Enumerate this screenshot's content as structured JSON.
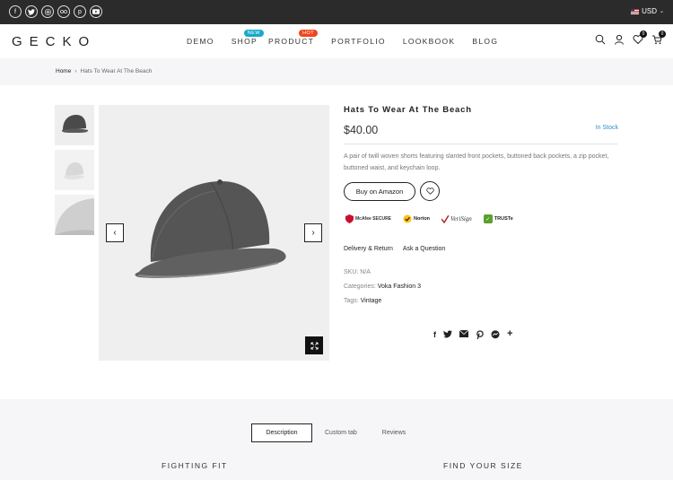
{
  "topbar": {
    "social": [
      "facebook-icon",
      "twitter-icon",
      "instagram-icon",
      "flickr-icon",
      "pinterest-icon",
      "youtube-icon"
    ],
    "currency": "USD"
  },
  "header": {
    "logo": "GECKO",
    "nav": [
      {
        "label": "DEMO"
      },
      {
        "label": "SHOP",
        "badge": "NEW"
      },
      {
        "label": "PRODUCT",
        "badge": "HOT"
      },
      {
        "label": "PORTFOLIO"
      },
      {
        "label": "LOOKBOOK"
      },
      {
        "label": "BLOG"
      }
    ],
    "wishlist_count": "0",
    "cart_count": "0"
  },
  "breadcrumb": {
    "home": "Home",
    "separator": "›",
    "current": "Hats To Wear At The Beach"
  },
  "product": {
    "title": "Hats To Wear At The Beach",
    "price": "$40.00",
    "stock": "In Stock",
    "description": "A pair of twill woven shorts featuring slanted front pockets, buttoned back pockets, a zip pocket, buttoned waist, and keychain loop.",
    "buy_label": "Buy on Amazon",
    "trust_badges": [
      "McAfee SECURE",
      "Norton",
      "VeriSign",
      "TRUSTe"
    ],
    "links": [
      "Delivery & Return",
      "Ask a Question"
    ],
    "sku_label": "SKU:",
    "sku": "N/A",
    "categories_label": "Categories:",
    "category": "Voka Fashion 3",
    "tags_label": "Tags:",
    "tag": "Vintage"
  },
  "tabs": [
    "Description",
    "Custom tab",
    "Reviews"
  ],
  "sections": {
    "left_title": "FIGHTING FIT",
    "right_title": "FIND YOUR SIZE"
  },
  "colors": {
    "topbar_bg": "#2b2b2b",
    "badge_new": "#16a9c9",
    "badge_hot": "#f0451e",
    "stock_color": "#2f8fc9"
  }
}
